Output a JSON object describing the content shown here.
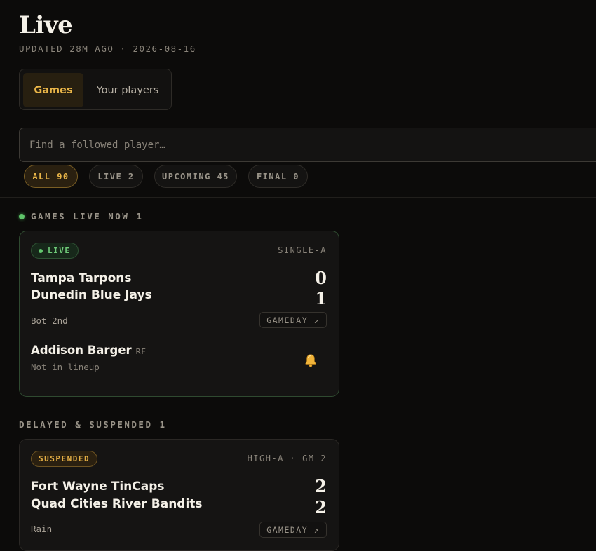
{
  "header": {
    "title": "Live",
    "updated": "UPDATED 28M AGO · 2026-08-16"
  },
  "tabs": {
    "games": "Games",
    "players": "Your players"
  },
  "search": {
    "placeholder": "Find a followed player…"
  },
  "filters": [
    {
      "label": "ALL 90",
      "active": true
    },
    {
      "label": "LIVE 2",
      "active": false
    },
    {
      "label": "UPCOMING 45",
      "active": false
    },
    {
      "label": "FINAL 0",
      "active": false
    }
  ],
  "sections": {
    "live": {
      "label": "GAMES LIVE NOW 1"
    },
    "delayed": {
      "label": "DELAYED & SUSPENDED 1"
    }
  },
  "cards": [
    {
      "status": "LIVE",
      "level": "SINGLE-A",
      "away_team": "Tampa Tarpons",
      "away_score": "0",
      "home_team": "Dunedin Blue Jays",
      "home_score": "1",
      "inning": "Bot 2nd",
      "gameday_label": "GAMEDAY ↗",
      "player": {
        "name": "Addison Barger",
        "position": "RF",
        "status": "Not in lineup",
        "icon": "bell-icon"
      }
    },
    {
      "status": "SUSPENDED",
      "level": "HIGH-A · GM 2",
      "away_team": "Fort Wayne TinCaps",
      "away_score": "2",
      "home_team": "Quad Cities River Bandits",
      "home_score": "2",
      "inning": "Rain",
      "gameday_label": "GAMEDAY ↗"
    }
  ],
  "colors": {
    "accent": "#e9b548",
    "live_green": "#63c76e",
    "background": "#0c0b0a"
  }
}
